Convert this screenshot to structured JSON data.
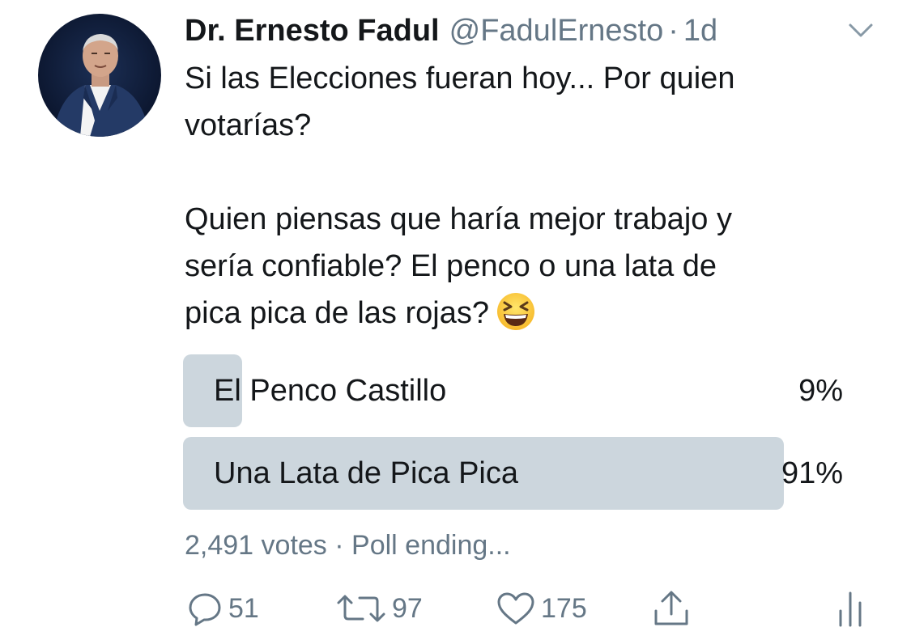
{
  "tweet": {
    "author_name": "Dr. Ernesto Fadul",
    "handle": "@FadulErnesto",
    "separator": "·",
    "time": "1d",
    "text_lines": [
      "Si las Elecciones fueran hoy... Por quien",
      "votarías?",
      "Quien piensas que haría mejor trabajo y",
      "sería confiable? El penco o una lata de",
      "pica pica de las rojas?"
    ],
    "emoji": "grinning-squinting-face-emoji"
  },
  "poll": {
    "options": [
      {
        "label": "El Penco Castillo",
        "percent_text": "9%",
        "percent": 9
      },
      {
        "label": "Una Lata de Pica Pica",
        "percent_text": "91%",
        "percent": 91
      }
    ],
    "bar_color": "#ccd6dd",
    "votes_text": "2,491 votes",
    "meta_separator": "·",
    "status_text": "Poll ending..."
  },
  "actions": {
    "reply_count": "51",
    "retweet_count": "97",
    "like_count": "175",
    "icons": [
      "reply-icon",
      "retweet-icon",
      "like-icon",
      "share-icon",
      "analytics-icon"
    ]
  },
  "colors": {
    "text_primary": "#14171a",
    "text_secondary": "#657786"
  }
}
